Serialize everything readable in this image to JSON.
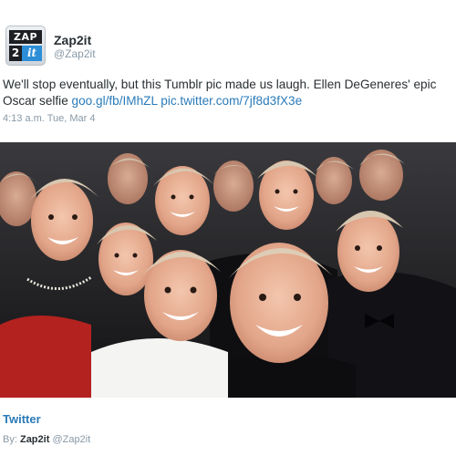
{
  "account": {
    "display_name": "Zap2it",
    "handle": "@Zap2it",
    "avatar_text_top": "ZAP",
    "avatar_text_num": "2",
    "avatar_text_it": "it"
  },
  "tweet": {
    "text_plain": "We'll stop eventually, but this Tumblr pic made us laugh. Ellen DeGeneres' epic Oscar selfie ",
    "link_1": "goo.gl/fb/IMhZL",
    "link_2": "pic.twitter.com/7jf8d3fX3e",
    "timestamp": "4:13 a.m. Tue, Mar 4"
  },
  "card": {
    "source_label": "Twitter",
    "byline_prefix": "By:",
    "byline_name": "Zap2it",
    "byline_handle": "@Zap2it"
  },
  "colors": {
    "link": "#2b7bb9",
    "muted": "#8899a6",
    "text": "#292f33"
  }
}
